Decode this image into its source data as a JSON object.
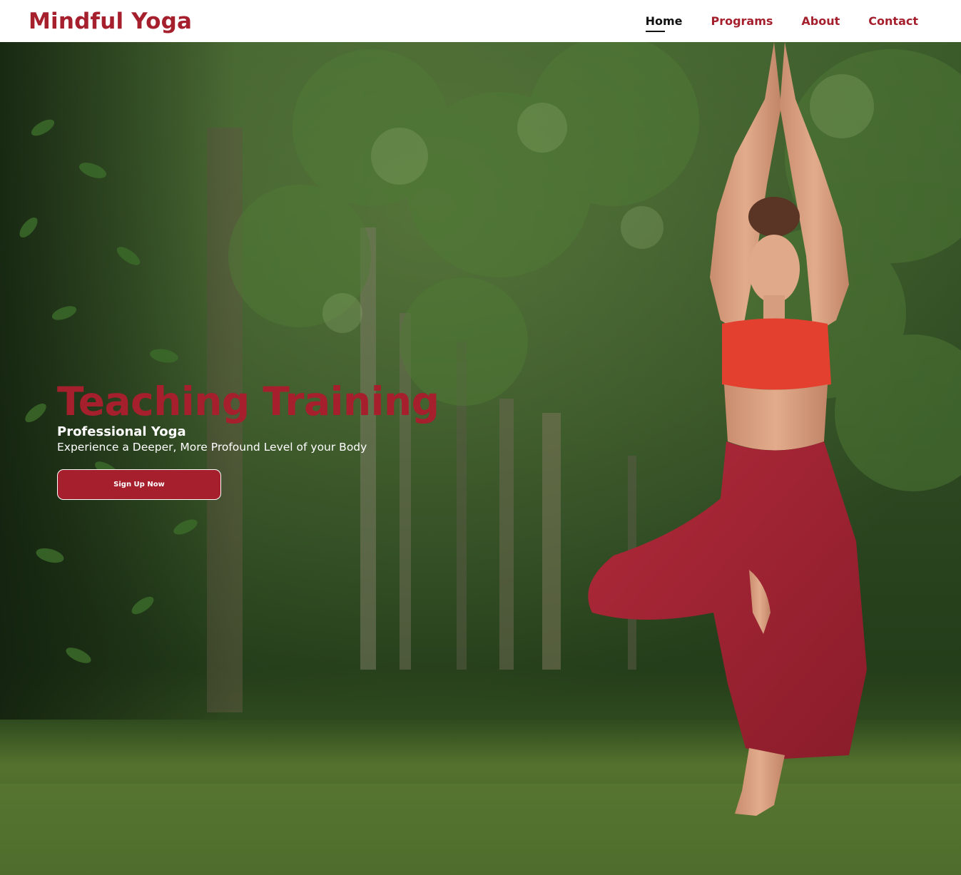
{
  "header": {
    "brand": "Mindful Yoga",
    "nav": [
      {
        "label": "Home",
        "active": true
      },
      {
        "label": "Programs",
        "active": false
      },
      {
        "label": "About",
        "active": false
      },
      {
        "label": "Contact",
        "active": false
      }
    ]
  },
  "hero": {
    "title": "Teaching Training",
    "subtitle": "Professional Yoga",
    "tagline": "Experience a Deeper, More Profound Level of your Body",
    "cta_label": "Sign Up Now",
    "image_description": "woman in tree pose on grass in a forest"
  },
  "colors": {
    "brand": "#a51f2d",
    "active_nav": "#111111",
    "hero_text": "#ffffff"
  }
}
